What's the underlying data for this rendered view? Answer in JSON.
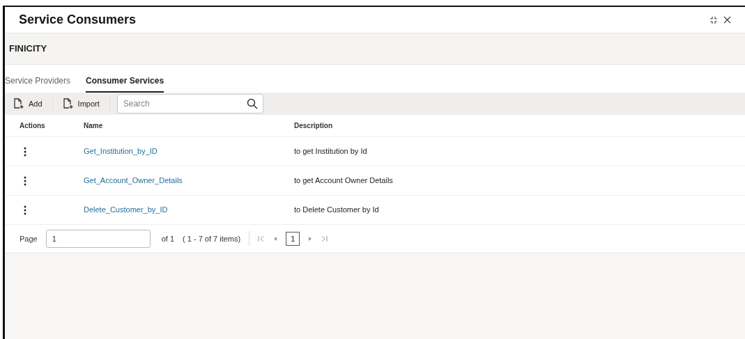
{
  "window": {
    "title": "Service Consumers"
  },
  "provider": "FINICITY",
  "tabs": [
    {
      "label": "Service Providers",
      "selected": false
    },
    {
      "label": "Consumer Services",
      "selected": true
    }
  ],
  "toolbar": {
    "buttons": [
      "Add",
      "Import"
    ],
    "search": {
      "placeholder": "Search"
    }
  },
  "table": {
    "columns": [
      "Actions",
      "Name",
      "Description"
    ],
    "rows": [
      {
        "name": "Get_Institution_by_ID",
        "description": "to get Institution by Id"
      },
      {
        "name": "Get_Account_Owner_Details",
        "description": "to get Account Owner Details"
      },
      {
        "name": "Delete_Customer_by_ID",
        "description": "to Delete Customer by Id"
      }
    ]
  },
  "pagination": {
    "label": "Page",
    "value": "1",
    "of": "of 1",
    "range": "( 1 - 7 of 7 items)",
    "pages": [
      {
        "label": "1",
        "selected": true
      }
    ]
  }
}
